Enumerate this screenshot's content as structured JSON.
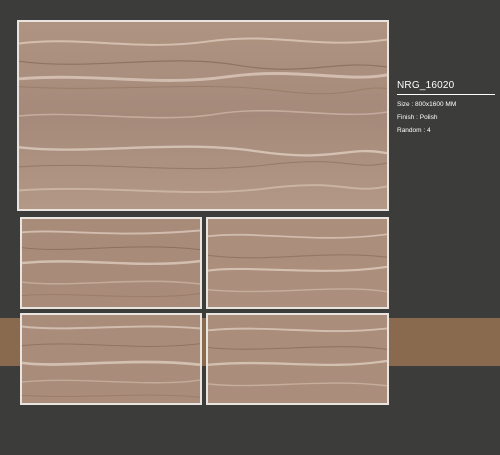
{
  "product": {
    "code": "NRG_16020",
    "size": "Size : 800x1600 MM",
    "finish": "Finish : Polish",
    "random": "Random : 4"
  },
  "colors": {
    "background": "#3c3c3a",
    "band": "#8a6a4e",
    "tile_border": "#e9e4df",
    "marble_base": "#a88a76",
    "vein_light": "#e2d2c4",
    "vein_dark": "#7d5f4d"
  },
  "tiles": [
    {
      "name": "main-marble-tile"
    },
    {
      "name": "marble-tile-1"
    },
    {
      "name": "marble-tile-2"
    },
    {
      "name": "marble-tile-3"
    },
    {
      "name": "marble-tile-4"
    }
  ]
}
